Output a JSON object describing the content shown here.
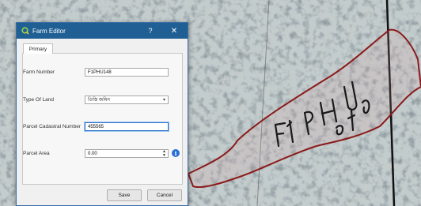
{
  "dialog": {
    "title": "Farm Editor",
    "help_glyph": "?",
    "close_glyph": "✕",
    "tabs": [
      {
        "label": "Primary"
      }
    ]
  },
  "form": {
    "farm_number": {
      "label": "Farm Number",
      "value": "F1PHU148"
    },
    "type_of_land": {
      "label": "Type Of Land",
      "value": "তিস্তি জমিন"
    },
    "parcel_cadastral_number": {
      "label": "Parcel Cadastral Number",
      "value": "455565"
    },
    "parcel_area": {
      "label": "Parcel Area",
      "value": "0.00"
    }
  },
  "buttons": {
    "save": "Save",
    "cancel": "Cancel"
  },
  "colors": {
    "titlebar": "#1f5f93",
    "focus": "#2b72c8",
    "info": "#2b6fd6",
    "polygon_outline": "#8b1a1a"
  },
  "icons": {
    "app": "qgis-icon",
    "info": "info-icon",
    "dropdown": "chevron-down-icon",
    "spin": "spinner-icon"
  }
}
